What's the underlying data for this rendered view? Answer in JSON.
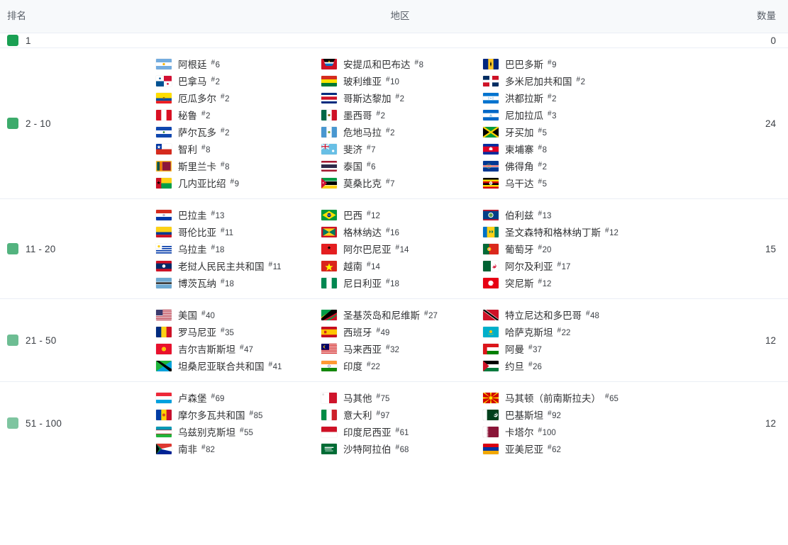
{
  "header": {
    "rank": "排名",
    "region": "地区",
    "count": "数量"
  },
  "colors": {
    "swatch_1": "#1aa053",
    "swatch_2_10": "#3cab6b",
    "swatch_11_20": "#53b37f",
    "swatch_21_50": "#6dbd93",
    "swatch_51_100": "#7ec5a0",
    "header_bg": "#f7f9fb",
    "border": "#ebeef5",
    "text": "#303133"
  },
  "rows": [
    {
      "rank_label": "1",
      "count": "0",
      "columns": [
        [],
        [],
        []
      ]
    },
    {
      "rank_label": "2 - 10",
      "count": "24",
      "columns": [
        [
          {
            "name": "阿根廷",
            "no": "6",
            "flag": "ar"
          },
          {
            "name": "巴拿马",
            "no": "2",
            "flag": "pa"
          },
          {
            "name": "厄瓜多尔",
            "no": "2",
            "flag": "ec"
          },
          {
            "name": "秘鲁",
            "no": "2",
            "flag": "pe"
          },
          {
            "name": "萨尔瓦多",
            "no": "2",
            "flag": "sv"
          },
          {
            "name": "智利",
            "no": "8",
            "flag": "cl"
          },
          {
            "name": "斯里兰卡",
            "no": "8",
            "flag": "lk"
          },
          {
            "name": "几内亚比绍",
            "no": "9",
            "flag": "gw"
          }
        ],
        [
          {
            "name": "安提瓜和巴布达",
            "no": "8",
            "flag": "ag"
          },
          {
            "name": "玻利维亚",
            "no": "10",
            "flag": "bo"
          },
          {
            "name": "哥斯达黎加",
            "no": "2",
            "flag": "cr"
          },
          {
            "name": "墨西哥",
            "no": "2",
            "flag": "mx"
          },
          {
            "name": "危地马拉",
            "no": "2",
            "flag": "gt"
          },
          {
            "name": "斐济",
            "no": "7",
            "flag": "fj"
          },
          {
            "name": "泰国",
            "no": "6",
            "flag": "th"
          },
          {
            "name": "莫桑比克",
            "no": "7",
            "flag": "mz"
          }
        ],
        [
          {
            "name": "巴巴多斯",
            "no": "9",
            "flag": "bb"
          },
          {
            "name": "多米尼加共和国",
            "no": "2",
            "flag": "do"
          },
          {
            "name": "洪都拉斯",
            "no": "2",
            "flag": "hn"
          },
          {
            "name": "尼加拉瓜",
            "no": "3",
            "flag": "ni"
          },
          {
            "name": "牙买加",
            "no": "5",
            "flag": "jm"
          },
          {
            "name": "柬埔寨",
            "no": "8",
            "flag": "kh"
          },
          {
            "name": "佛得角",
            "no": "2",
            "flag": "cv"
          },
          {
            "name": "乌干达",
            "no": "5",
            "flag": "ug"
          }
        ]
      ]
    },
    {
      "rank_label": "11 - 20",
      "count": "15",
      "columns": [
        [
          {
            "name": "巴拉圭",
            "no": "13",
            "flag": "py"
          },
          {
            "name": "哥伦比亚",
            "no": "11",
            "flag": "co"
          },
          {
            "name": "乌拉圭",
            "no": "18",
            "flag": "uy"
          },
          {
            "name": "老挝人民民主共和国",
            "no": "11",
            "flag": "la"
          },
          {
            "name": "博茨瓦纳",
            "no": "18",
            "flag": "bw"
          }
        ],
        [
          {
            "name": "巴西",
            "no": "12",
            "flag": "br"
          },
          {
            "name": "格林纳达",
            "no": "16",
            "flag": "gd"
          },
          {
            "name": "阿尔巴尼亚",
            "no": "14",
            "flag": "al"
          },
          {
            "name": "越南",
            "no": "14",
            "flag": "vn"
          },
          {
            "name": "尼日利亚",
            "no": "18",
            "flag": "ng"
          }
        ],
        [
          {
            "name": "伯利兹",
            "no": "13",
            "flag": "bz"
          },
          {
            "name": "圣文森特和格林纳丁斯",
            "no": "12",
            "flag": "vc"
          },
          {
            "name": "葡萄牙",
            "no": "20",
            "flag": "pt"
          },
          {
            "name": "阿尔及利亚",
            "no": "17",
            "flag": "dz"
          },
          {
            "name": "突尼斯",
            "no": "12",
            "flag": "tn"
          }
        ]
      ]
    },
    {
      "rank_label": "21 - 50",
      "count": "12",
      "columns": [
        [
          {
            "name": "美国",
            "no": "40",
            "flag": "us"
          },
          {
            "name": "罗马尼亚",
            "no": "35",
            "flag": "ro"
          },
          {
            "name": "吉尔吉斯斯坦",
            "no": "47",
            "flag": "kg"
          },
          {
            "name": "坦桑尼亚联合共和国",
            "no": "41",
            "flag": "tz"
          }
        ],
        [
          {
            "name": "圣基茨岛和尼维斯",
            "no": "27",
            "flag": "kn"
          },
          {
            "name": "西班牙",
            "no": "49",
            "flag": "es"
          },
          {
            "name": "马来西亚",
            "no": "32",
            "flag": "my"
          },
          {
            "name": "印度",
            "no": "22",
            "flag": "in"
          }
        ],
        [
          {
            "name": "特立尼达和多巴哥",
            "no": "48",
            "flag": "tt"
          },
          {
            "name": "哈萨克斯坦",
            "no": "22",
            "flag": "kz"
          },
          {
            "name": "阿曼",
            "no": "37",
            "flag": "om"
          },
          {
            "name": "约旦",
            "no": "26",
            "flag": "jo"
          }
        ]
      ]
    },
    {
      "rank_label": "51 - 100",
      "count": "12",
      "columns": [
        [
          {
            "name": "卢森堡",
            "no": "69",
            "flag": "lu"
          },
          {
            "name": "摩尔多瓦共和国",
            "no": "85",
            "flag": "md"
          },
          {
            "name": "乌兹别克斯坦",
            "no": "55",
            "flag": "uz"
          },
          {
            "name": "南非",
            "no": "82",
            "flag": "za"
          }
        ],
        [
          {
            "name": "马其他",
            "no": "75",
            "flag": "mt"
          },
          {
            "name": "意大利",
            "no": "97",
            "flag": "it"
          },
          {
            "name": "印度尼西亚",
            "no": "61",
            "flag": "id"
          },
          {
            "name": "沙特阿拉伯",
            "no": "68",
            "flag": "sa"
          }
        ],
        [
          {
            "name": "马其顿（前南斯拉夫）",
            "no": "65",
            "flag": "mk"
          },
          {
            "name": "巴基斯坦",
            "no": "92",
            "flag": "pk"
          },
          {
            "name": "卡塔尔",
            "no": "100",
            "flag": "qa"
          },
          {
            "name": "亚美尼亚",
            "no": "62",
            "flag": "am"
          }
        ]
      ]
    }
  ]
}
